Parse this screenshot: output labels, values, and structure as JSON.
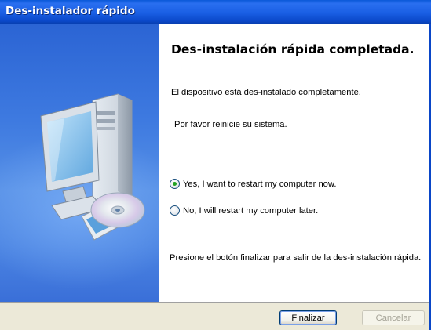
{
  "window": {
    "title": "Des-instalador rápido"
  },
  "main": {
    "heading": "Des-instalación rápida completada.",
    "line1": "El dispositivo está des-instalado completamente.",
    "line2": "Por favor reinicie su sistema.",
    "options": [
      {
        "label": "Yes, I want to restart my computer now.",
        "checked": true
      },
      {
        "label": "No, I will restart my computer later.",
        "checked": false
      }
    ],
    "footer_text": "Presione el botón finalizar para salir de la des-instalación rápida."
  },
  "buttons": {
    "finish": "Finalizar",
    "cancel": "Cancelar"
  },
  "colors": {
    "titlebar": "#0a58d8",
    "sidepanel": "#3e7ae0",
    "radio_check": "#21a121"
  }
}
